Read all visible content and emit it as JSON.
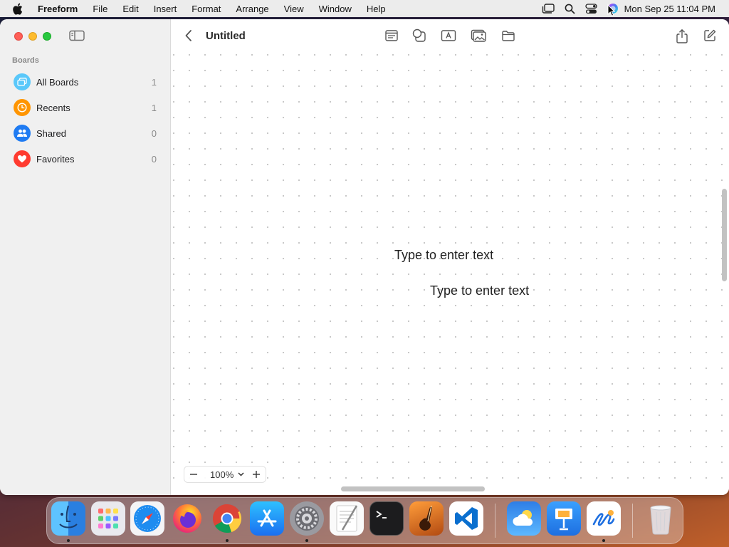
{
  "menubar": {
    "app_name": "Freeform",
    "items": [
      "File",
      "Edit",
      "Insert",
      "Format",
      "Arrange",
      "View",
      "Window",
      "Help"
    ],
    "clock": "Mon Sep 25  11:04 PM",
    "status_icons": [
      "stage-manager-icon",
      "spotlight-search-icon",
      "control-center-icon",
      "siri-icon"
    ]
  },
  "window": {
    "title": "Untitled"
  },
  "sidebar": {
    "heading": "Boards",
    "items": [
      {
        "label": "All Boards",
        "count": "1",
        "icon": "all-boards-icon",
        "color": "#5ac8fa"
      },
      {
        "label": "Recents",
        "count": "1",
        "icon": "clock-icon",
        "color": "#ff9500"
      },
      {
        "label": "Shared",
        "count": "0",
        "icon": "people-icon",
        "color": "#1f7bf2"
      },
      {
        "label": "Favorites",
        "count": "0",
        "icon": "heart-icon",
        "color": "#ff3b30"
      }
    ]
  },
  "toolbar": {
    "buttons": [
      "sticky-note-icon",
      "shapes-icon",
      "text-box-icon",
      "media-icon",
      "files-icon",
      "share-icon",
      "compose-icon"
    ]
  },
  "canvas": {
    "textboxes": [
      "Type to enter text",
      "Type to enter text"
    ]
  },
  "zoom": {
    "value": "100%"
  },
  "dock": {
    "apps": [
      "Finder",
      "Launchpad",
      "Safari",
      "Firefox",
      "Google Chrome",
      "App Store",
      "System Settings",
      "TextEdit",
      "Terminal",
      "GarageBand",
      "Visual Studio Code",
      "Weather",
      "Keynote",
      "Freeform",
      "Trash"
    ],
    "running": [
      "Finder",
      "Google Chrome",
      "System Settings",
      "Freeform"
    ]
  }
}
